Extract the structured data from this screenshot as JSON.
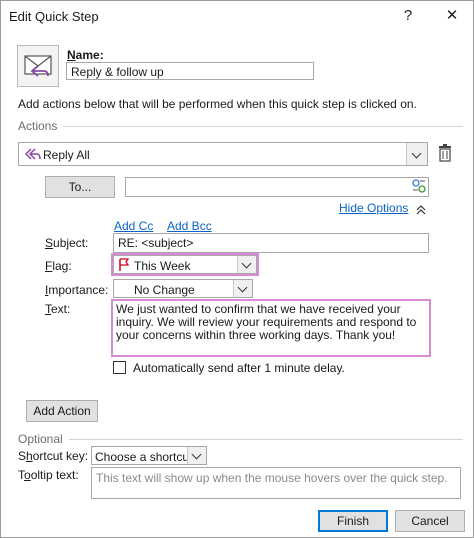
{
  "window": {
    "title": "Edit Quick Step",
    "help_glyph": "?",
    "close_glyph": "✕"
  },
  "name": {
    "label": "Name:",
    "value": "Reply & follow up",
    "icon": "envelope-reply-icon"
  },
  "instruction": "Add actions below that will be performed when this quick step is clicked on.",
  "actions_section": "Actions",
  "action": {
    "selected": "Reply All",
    "icon": "reply-all-icon",
    "delete_icon": "trash-icon",
    "to_button": "To...",
    "to_value": "",
    "address_book_icon": "address-book-icon",
    "hide_options": "Hide Options",
    "add_cc": "Add Cc",
    "add_bcc": "Add Bcc",
    "subject_label": "Subject:",
    "subject_value": "RE: <subject>",
    "flag_label": "Flag:",
    "flag_value": "This Week",
    "flag_icon": "red-flag-icon",
    "importance_label": "Importance:",
    "importance_value": "No Change",
    "text_label": "Text:",
    "text_value": "We just wanted to confirm that we have received your inquiry. We will review your requirements and respond to your concerns within three working days. Thank you!",
    "auto_send_label": "Automatically send after 1 minute delay.",
    "auto_send_checked": false
  },
  "add_action_button": "Add Action",
  "optional_section": "Optional",
  "shortcut": {
    "label": "Shortcut key:",
    "value": "Choose a shortcut"
  },
  "tooltip": {
    "label": "Tooltip text:",
    "placeholder": "This text will show up when the mouse hovers over the quick step."
  },
  "footer": {
    "finish": "Finish",
    "cancel": "Cancel"
  },
  "colors": {
    "highlight": "#d98ad6",
    "link": "#0b63c7",
    "accent": "#0078d7",
    "flag": "#d0021b"
  }
}
